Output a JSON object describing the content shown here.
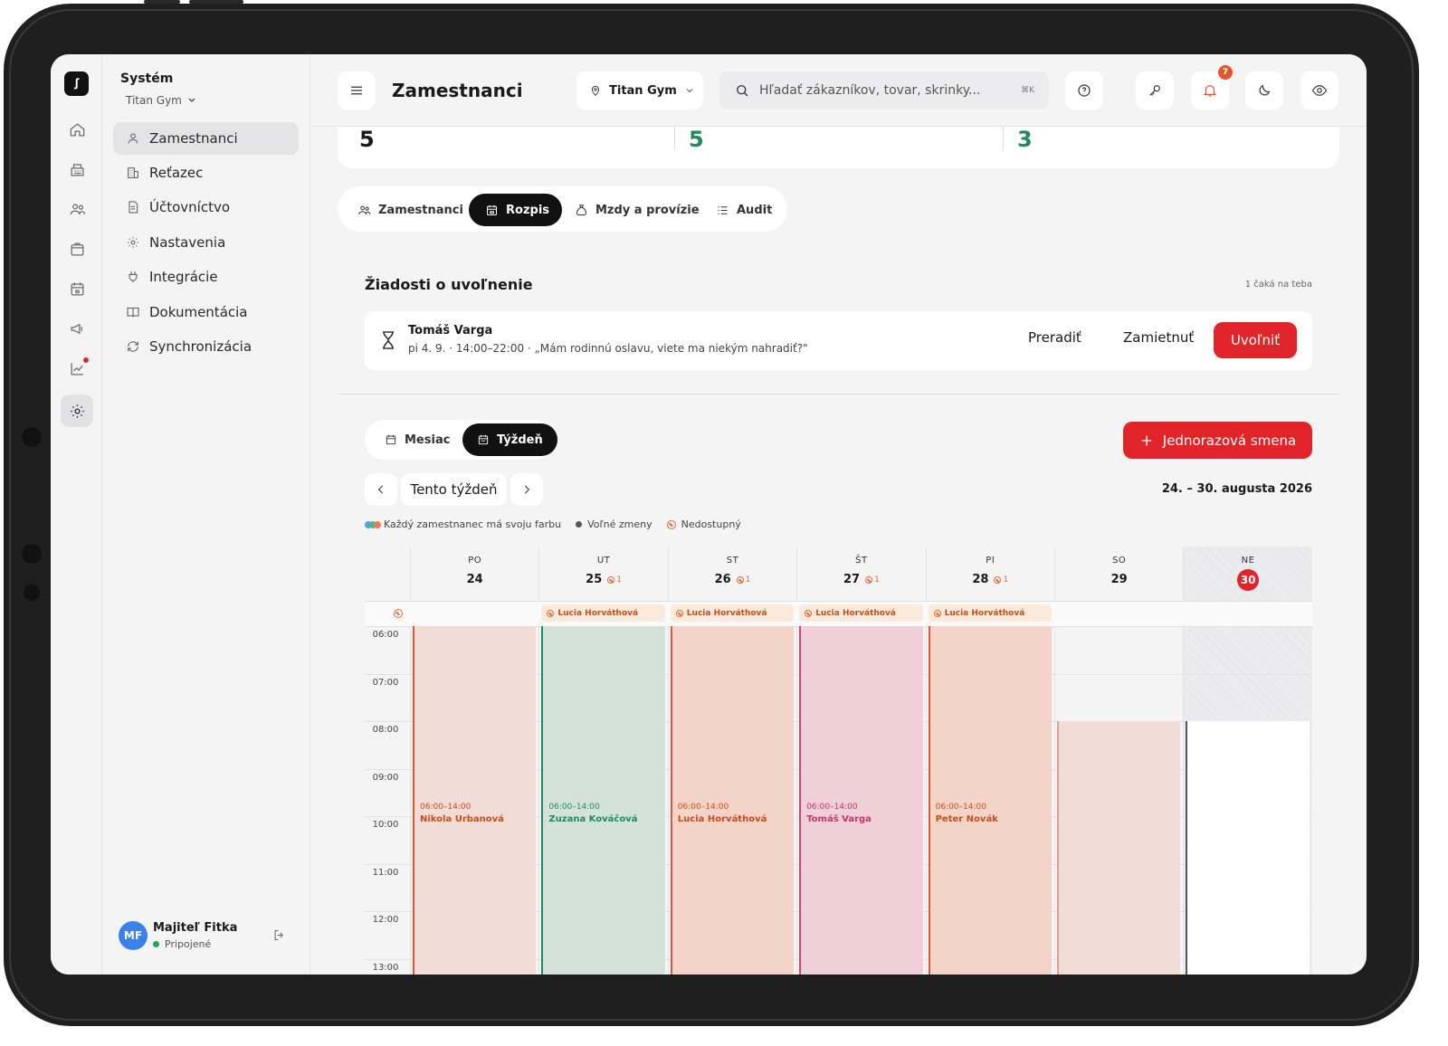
{
  "sidebar": {
    "title": "Systém",
    "subtitle": "Titan Gym",
    "items": [
      {
        "label": "Zamestnanci",
        "icon": "user-icon"
      },
      {
        "label": "Reťazec",
        "icon": "building-icon"
      },
      {
        "label": "Účtovníctvo",
        "icon": "document-icon"
      },
      {
        "label": "Nastavenia",
        "icon": "gear-icon"
      },
      {
        "label": "Integrácie",
        "icon": "plug-icon"
      },
      {
        "label": "Dokumentácia",
        "icon": "book-icon"
      },
      {
        "label": "Synchronizácia",
        "icon": "sync-icon"
      }
    ],
    "user": {
      "initials": "MF",
      "name": "Majiteľ Fitka",
      "status": "Pripojené"
    }
  },
  "topbar": {
    "title": "Zamestnanci",
    "location": "Titan Gym",
    "search_placeholder": "Hľadať zákazníkov, tovar, skrinky...",
    "search_shortcut": "⌘K",
    "notification_count": "7"
  },
  "stats": {
    "values": [
      "5",
      "5",
      "3"
    ],
    "colors": [
      "#1a1a1a",
      "#1f8a5b",
      "#1f8a5b"
    ]
  },
  "tabs": [
    {
      "label": "Zamestnanci",
      "icon": "users-icon"
    },
    {
      "label": "Rozpis",
      "icon": "calendar-icon",
      "active": true
    },
    {
      "label": "Mzdy a provízie",
      "icon": "money-bag-icon"
    },
    {
      "label": "Audit",
      "icon": "list-icon"
    }
  ],
  "requests": {
    "title": "Žiadosti o uvoľnenie",
    "count_label": "1 čaká na teba",
    "item": {
      "name": "Tomáš Varga",
      "detail": "pi 4. 9. · 14:00–22:00 · „Mám rodinnú oslavu, viete ma niekým nahradiť?\"",
      "actions": [
        "Preradiť",
        "Zamietnuť"
      ],
      "primary": "Uvoľniť"
    }
  },
  "schedule": {
    "views": [
      "Mesiac",
      "Týždeň"
    ],
    "active_view": "Týždeň",
    "add_label": "Jednorazová smena",
    "today_label": "Tento týždeň",
    "range": "24. – 30. augusta 2026",
    "legend": [
      "Každý zamestnanec má svoju farbu",
      "Voľné zmeny",
      "Nedostupný"
    ],
    "days": [
      {
        "name": "PO",
        "num": "24",
        "blocked": ""
      },
      {
        "name": "UT",
        "num": "25",
        "blocked": "1"
      },
      {
        "name": "ST",
        "num": "26",
        "blocked": "1"
      },
      {
        "name": "ŠT",
        "num": "27",
        "blocked": "1"
      },
      {
        "name": "PI",
        "num": "28",
        "blocked": "1"
      },
      {
        "name": "SO",
        "num": "29",
        "blocked": ""
      },
      {
        "name": "NE",
        "num": "30",
        "blocked": "",
        "today": true
      }
    ],
    "unavailable": [
      "",
      "Lucia Horváthová",
      "Lucia Horváthová",
      "Lucia Horváthová",
      "Lucia Horváthová",
      "",
      ""
    ],
    "times": [
      "06:00",
      "07:00",
      "08:00",
      "09:00",
      "10:00",
      "11:00",
      "12:00",
      "13:00"
    ],
    "shifts": [
      {
        "day": 0,
        "start": 6,
        "time": "06:00–14:00",
        "name": "Nikola Urbanová",
        "bg": "#f2dcd7",
        "border": "#d9573a",
        "text": "#c64d1a"
      },
      {
        "day": 1,
        "start": 6,
        "time": "06:00–14:00",
        "name": "Zuzana Kováčová",
        "bg": "#d4e3da",
        "border": "#1f8a5b",
        "text": "#1f8a5b"
      },
      {
        "day": 2,
        "start": 6,
        "time": "06:00–14:00",
        "name": "Lucia Horváthová",
        "bg": "#f4d4c9",
        "border": "#d9573a",
        "text": "#c64d1a"
      },
      {
        "day": 3,
        "start": 6,
        "time": "06:00–14:00",
        "name": "Tomáš Varga",
        "bg": "#efd0d9",
        "border": "#d6427a",
        "text": "#c6346a"
      },
      {
        "day": 4,
        "start": 6,
        "time": "06:00–14:00",
        "name": "Peter Novák",
        "bg": "#f4d4c9",
        "border": "#d9573a",
        "text": "#c64d1a"
      },
      {
        "day": 5,
        "start": 8,
        "time": "",
        "name": "",
        "bg": "#f2dcd7",
        "border": "#e0a090",
        "text": "#c64d1a"
      },
      {
        "day": 6,
        "start": 8,
        "time": "",
        "name": "",
        "bg": "#ffffff",
        "border": "#555555",
        "text": "#333"
      }
    ]
  }
}
